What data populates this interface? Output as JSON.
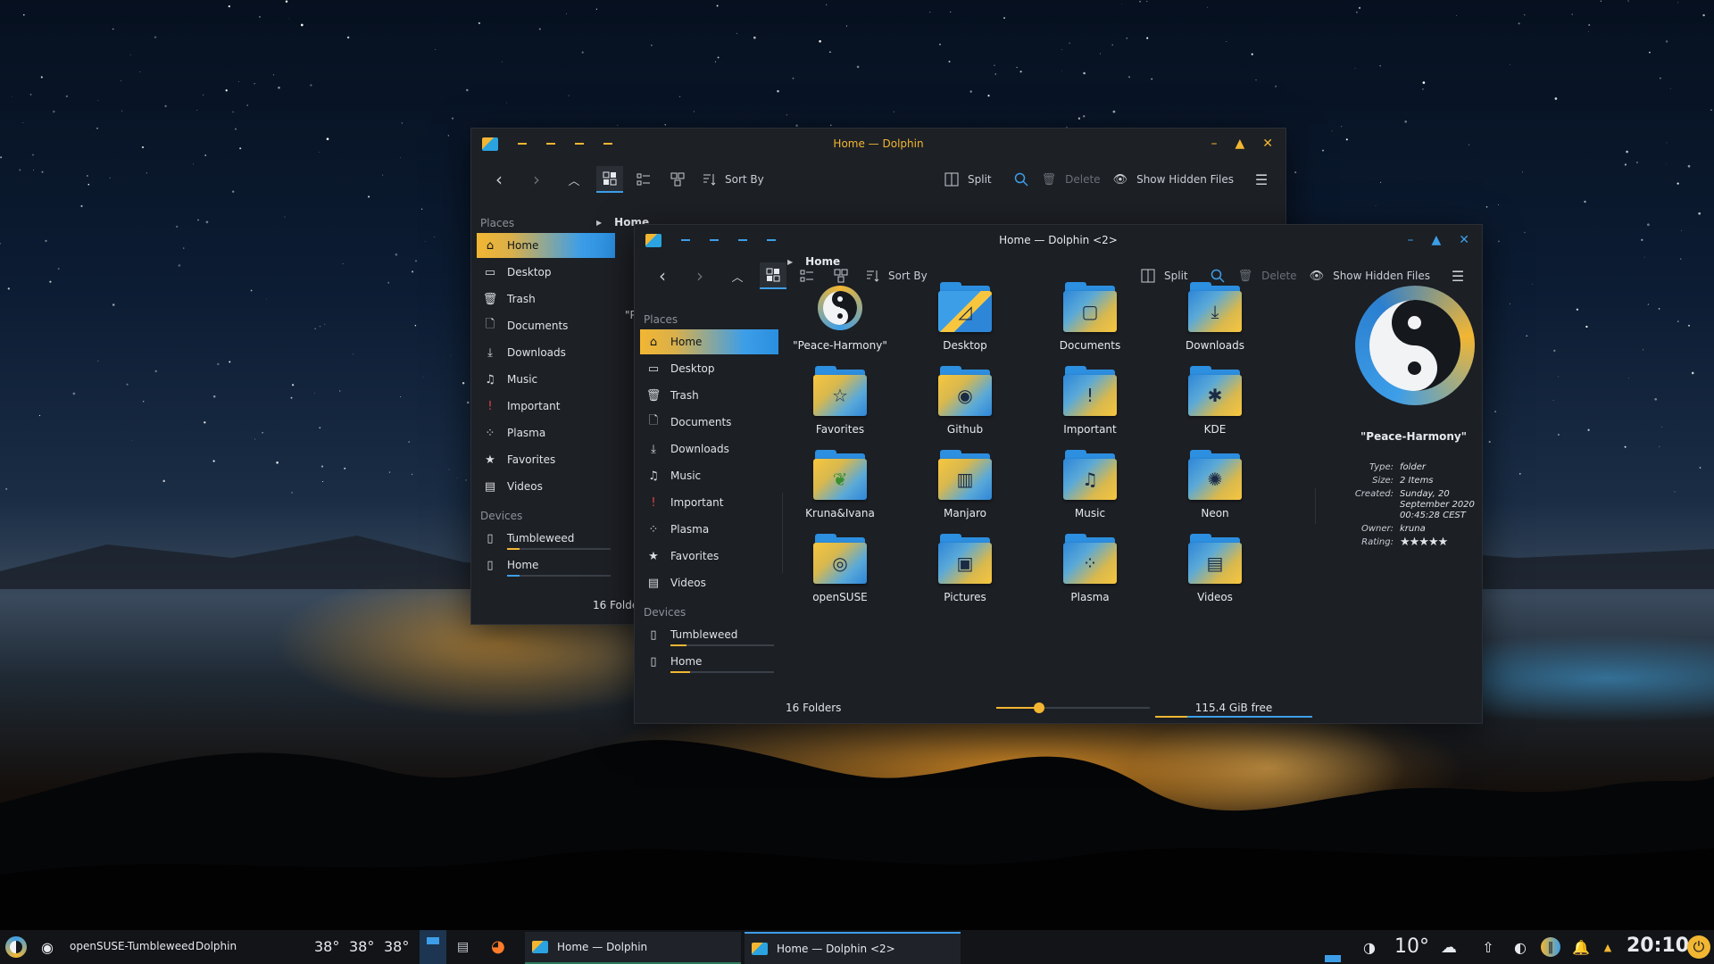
{
  "back_window": {
    "title": "Home — Dolphin",
    "toolbar": {
      "sort_by": "Sort By",
      "split": "Split",
      "delete": "Delete",
      "show_hidden": "Show Hidden Files"
    },
    "places_header": "Places",
    "places": [
      "Home",
      "Desktop",
      "Trash",
      "Documents",
      "Downloads",
      "Music",
      "Important",
      "Plasma",
      "Favorites",
      "Videos"
    ],
    "devices_header": "Devices",
    "devices": [
      "Tumbleweed",
      "Home"
    ],
    "crumb": "Home",
    "status_partial": "16 Folde",
    "partial_name": "\"P"
  },
  "front_window": {
    "title": "Home — Dolphin <2>",
    "toolbar": {
      "sort_by": "Sort By",
      "split": "Split",
      "delete": "Delete",
      "show_hidden": "Show Hidden Files"
    },
    "places_header": "Places",
    "places": [
      "Home",
      "Desktop",
      "Trash",
      "Documents",
      "Downloads",
      "Music",
      "Important",
      "Plasma",
      "Favorites",
      "Videos"
    ],
    "devices_header": "Devices",
    "devices": [
      "Tumbleweed",
      "Home"
    ],
    "crumb": "Home",
    "folders": [
      {
        "name": "\"Peace-Harmony\"",
        "icon": "yin-yang-icon"
      },
      {
        "name": "Desktop",
        "icon": "desktop-folder-icon"
      },
      {
        "name": "Documents",
        "icon": "documents-folder-icon"
      },
      {
        "name": "Downloads",
        "icon": "downloads-folder-icon"
      },
      {
        "name": "Favorites",
        "icon": "favorites-folder-icon"
      },
      {
        "name": "Github",
        "icon": "github-folder-icon"
      },
      {
        "name": "Important",
        "icon": "important-folder-icon"
      },
      {
        "name": "KDE",
        "icon": "kde-folder-icon"
      },
      {
        "name": "Kruna&Ivana",
        "icon": "kruna-ivana-folder-icon"
      },
      {
        "name": "Manjaro",
        "icon": "manjaro-folder-icon"
      },
      {
        "name": "Music",
        "icon": "music-folder-icon"
      },
      {
        "name": "Neon",
        "icon": "neon-folder-icon"
      },
      {
        "name": "openSUSE",
        "icon": "opensuse-folder-icon"
      },
      {
        "name": "Pictures",
        "icon": "pictures-folder-icon"
      },
      {
        "name": "Plasma",
        "icon": "plasma-folder-icon"
      },
      {
        "name": "Videos",
        "icon": "videos-folder-icon"
      }
    ],
    "info": {
      "name": "\"Peace-Harmony\"",
      "type_k": "Type:",
      "type_v": "folder",
      "size_k": "Size:",
      "size_v": "2 Items",
      "created_k": "Created:",
      "created_v": "Sunday, 20 September 2020 00:45:28 CEST",
      "owner_k": "Owner:",
      "owner_v": "kruna",
      "rating_k": "Rating:",
      "rating_v": "★★★★★"
    },
    "status": {
      "count": "16 Folders",
      "zoom_fraction": 0.28,
      "free": "115.4 GiB free"
    }
  },
  "taskbar": {
    "app_title": "openSUSE-Tumbleweed",
    "app_name": "Dolphin",
    "temps": [
      "38°",
      "38°",
      "38°"
    ],
    "tasks": [
      "Home — Dolphin",
      "Home — Dolphin <2>"
    ],
    "weather": "10°",
    "clock": "20:10"
  },
  "colors": {
    "accent_yellow": "#f2b632",
    "accent_blue": "#3d9ee8",
    "window_bg": "#1c1f24"
  }
}
